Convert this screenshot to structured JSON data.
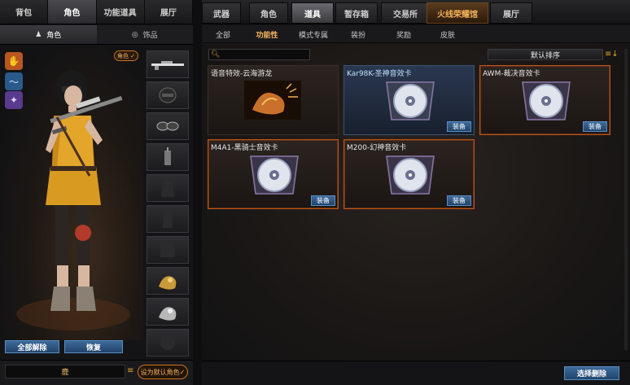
{
  "left_tabs": [
    "背包",
    "角色",
    "功能道具",
    "展厅"
  ],
  "left_sub_tabs": [
    "角色",
    "饰品"
  ],
  "role_badge": "角色",
  "buttons": {
    "remove_all": "全部解除",
    "restore": "恢复"
  },
  "character_name": "鹿",
  "set_default_button": "设为默认角色",
  "right_tabs": [
    "武器",
    "角色",
    "道具",
    "暂存箱",
    "交易所",
    "火线荣耀馆",
    "展厅"
  ],
  "right_sub_tabs": [
    "全部",
    "功能性",
    "模式专属",
    "装扮",
    "奖励",
    "皮肤"
  ],
  "sort_label": "默认排序",
  "equip_label": "装备",
  "cards": [
    {
      "name": "语音特效-云海游龙"
    },
    {
      "name": "Kar98K-圣神音效卡"
    },
    {
      "name": "AWM-裁决音效卡"
    },
    {
      "name": "M4A1-黑骑士音效卡"
    },
    {
      "name": "M200-幻神音效卡"
    }
  ],
  "select_remove_button": "选择删除",
  "colors": {
    "accent_orange": "#e3a531",
    "button_blue": "#2f5a88",
    "selected_border": "#b8551f"
  }
}
